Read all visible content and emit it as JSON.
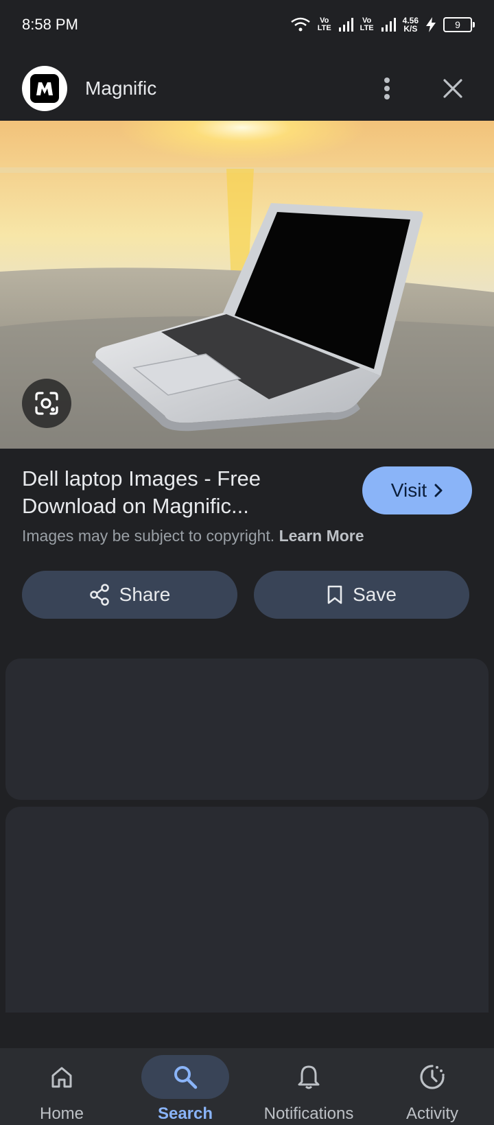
{
  "status_bar": {
    "time": "8:58 PM",
    "net1": "Vo\nLTE",
    "net2": "Vo\nLTE",
    "speed": "4.56\nK/S",
    "battery": "9"
  },
  "header": {
    "site_name": "Magnific",
    "logo_icon": "magnific-logo",
    "more_icon": "more-vert-icon",
    "close_icon": "close-icon"
  },
  "result": {
    "title": "Dell laptop Images - Free Download on Magnific...",
    "visit_label": "Visit",
    "copyright_text": "Images may be subject to copyright.",
    "learn_more": "Learn More",
    "share_label": "Share",
    "save_label": "Save"
  },
  "bottom_nav": {
    "items": [
      {
        "label": "Home",
        "icon": "home-icon"
      },
      {
        "label": "Search",
        "icon": "search-icon"
      },
      {
        "label": "Notifications",
        "icon": "bell-icon"
      },
      {
        "label": "Activity",
        "icon": "activity-icon"
      }
    ],
    "active": "Search"
  },
  "colors": {
    "background": "#202124",
    "accent": "#8ab4f8",
    "button": "#394457",
    "card": "#292b31"
  }
}
